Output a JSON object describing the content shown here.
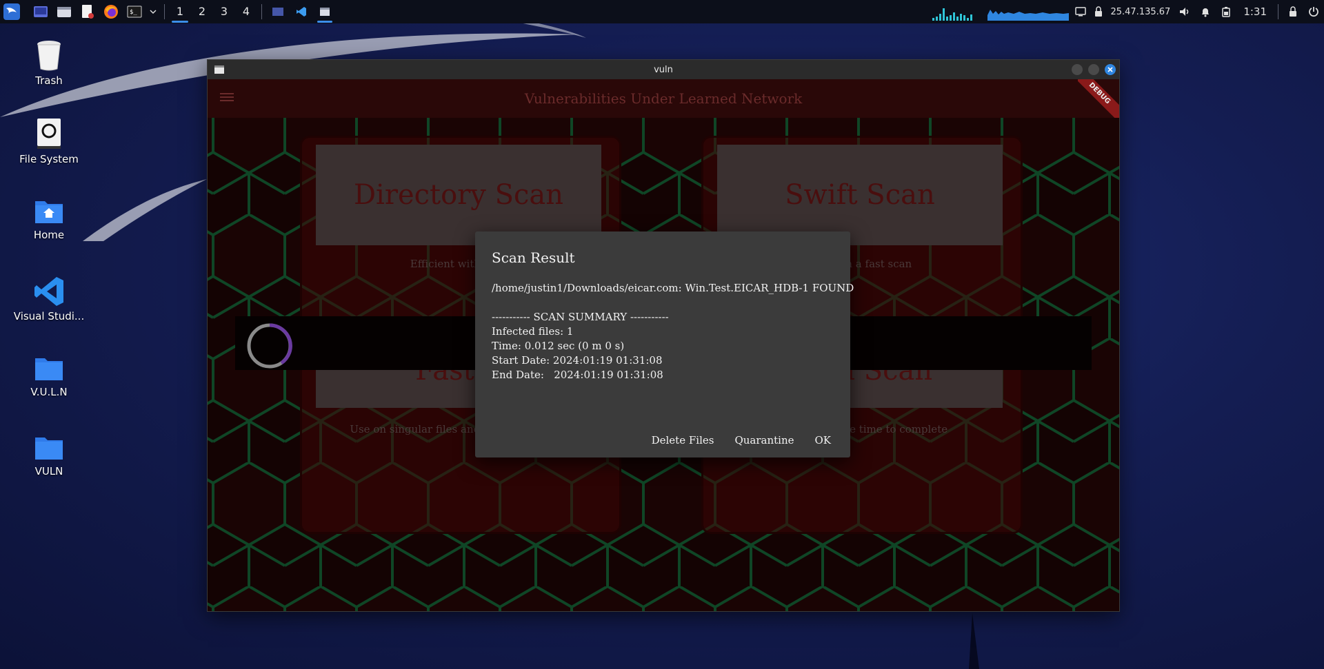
{
  "taskbar": {
    "workspaces": [
      "1",
      "2",
      "3",
      "4"
    ],
    "active_workspace": "1",
    "ip_address": "25.47.135.67",
    "clock": "1:31",
    "icons": [
      "kali-menu-icon",
      "desktop-icon",
      "file-manager-icon",
      "text-editor-icon",
      "firefox-icon",
      "terminal-icon"
    ]
  },
  "desktop": {
    "icons": [
      {
        "label": "Trash",
        "icon": "trash-icon"
      },
      {
        "label": "File System",
        "icon": "drive-icon"
      },
      {
        "label": "Home",
        "icon": "home-folder-icon"
      },
      {
        "label": "Visual Studi...",
        "icon": "vscode-icon"
      },
      {
        "label": "V.U.L.N",
        "icon": "folder-icon"
      },
      {
        "label": "VULN",
        "icon": "folder-icon"
      }
    ]
  },
  "window": {
    "title": "vuln",
    "app_title": "Vulnerabilities Under Learned Network",
    "debug_banner": "DEBUG",
    "cards": [
      {
        "title": "Directory Scan",
        "desc": "Efficient with large"
      },
      {
        "title": "Swift Scan",
        "desc": "gh then a fast scan"
      },
      {
        "title": "Fast S",
        "desc": "Use on singular files and small directories"
      },
      {
        "title": "stem Scan",
        "desc": "May take some time to complete"
      }
    ]
  },
  "dialog": {
    "title": "Scan Result",
    "found_line": "/home/justin1/Downloads/eicar.com: Win.Test.EICAR_HDB-1 FOUND",
    "summary_header": "----------- SCAN SUMMARY -----------",
    "infected": "Infected files: 1",
    "time": "Time: 0.012 sec (0 m 0 s)",
    "start_date": "Start Date: 2024:01:19 01:31:08",
    "end_date": "End Date:   2024:01:19 01:31:08",
    "actions": {
      "delete": "Delete Files",
      "quarantine": "Quarantine",
      "ok": "OK"
    }
  },
  "colors": {
    "accent": "#3b8eea",
    "app_bg": "#1a0606",
    "hex_lines": "#0f6b3a",
    "dialog_bg": "#3b3b3b"
  }
}
